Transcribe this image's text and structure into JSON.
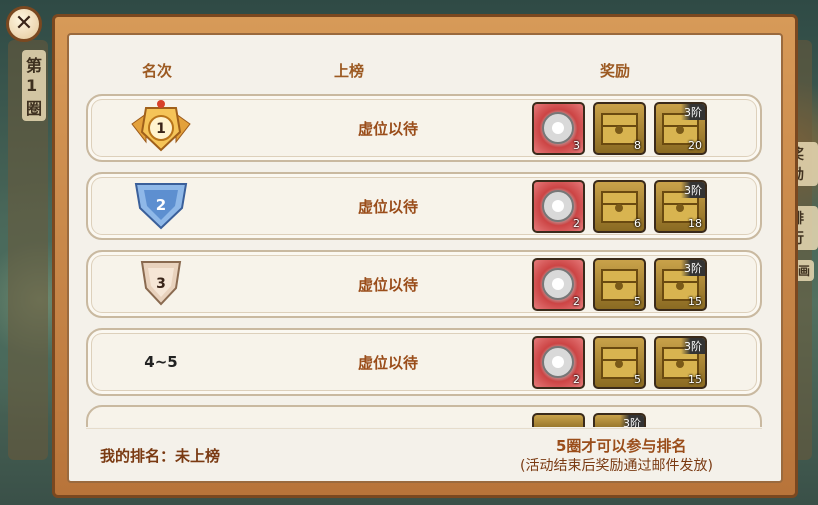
{
  "header": {
    "rank_col": "名次",
    "onlist_col": "上榜",
    "reward_col": "奖励"
  },
  "background": {
    "left_label_1": "第",
    "left_label_2": "1",
    "left_label_3": "圈",
    "right_label_1": "奖励",
    "right_label_2": "排行",
    "right_label_3": "动画"
  },
  "rows": [
    {
      "rank": "1",
      "name": "虚位以待",
      "tier": "3阶",
      "rewards": [
        "3",
        "8",
        "20"
      ]
    },
    {
      "rank": "2",
      "name": "虚位以待",
      "tier": "3阶",
      "rewards": [
        "2",
        "6",
        "18"
      ]
    },
    {
      "rank": "3",
      "name": "虚位以待",
      "tier": "3阶",
      "rewards": [
        "2",
        "5",
        "15"
      ]
    },
    {
      "rank": "4~5",
      "name": "虚位以待",
      "tier": "3阶",
      "rewards": [
        "2",
        "5",
        "15"
      ]
    }
  ],
  "partial_row": {
    "tier": "3阶"
  },
  "footer": {
    "my_rank": "我的排名：未上榜",
    "requirement": "5圈才可以参与排名",
    "note": "(活动结束后奖励通过邮件发放)"
  },
  "colors": {
    "frame": "#c8864a",
    "panel": "#f4f1ea",
    "accent_text": "#9a4d1a",
    "header_text": "#9c5a22"
  },
  "icons": {
    "close": "close-icon",
    "gem": "silver-orb-icon",
    "box": "treasure-chest-icon"
  }
}
